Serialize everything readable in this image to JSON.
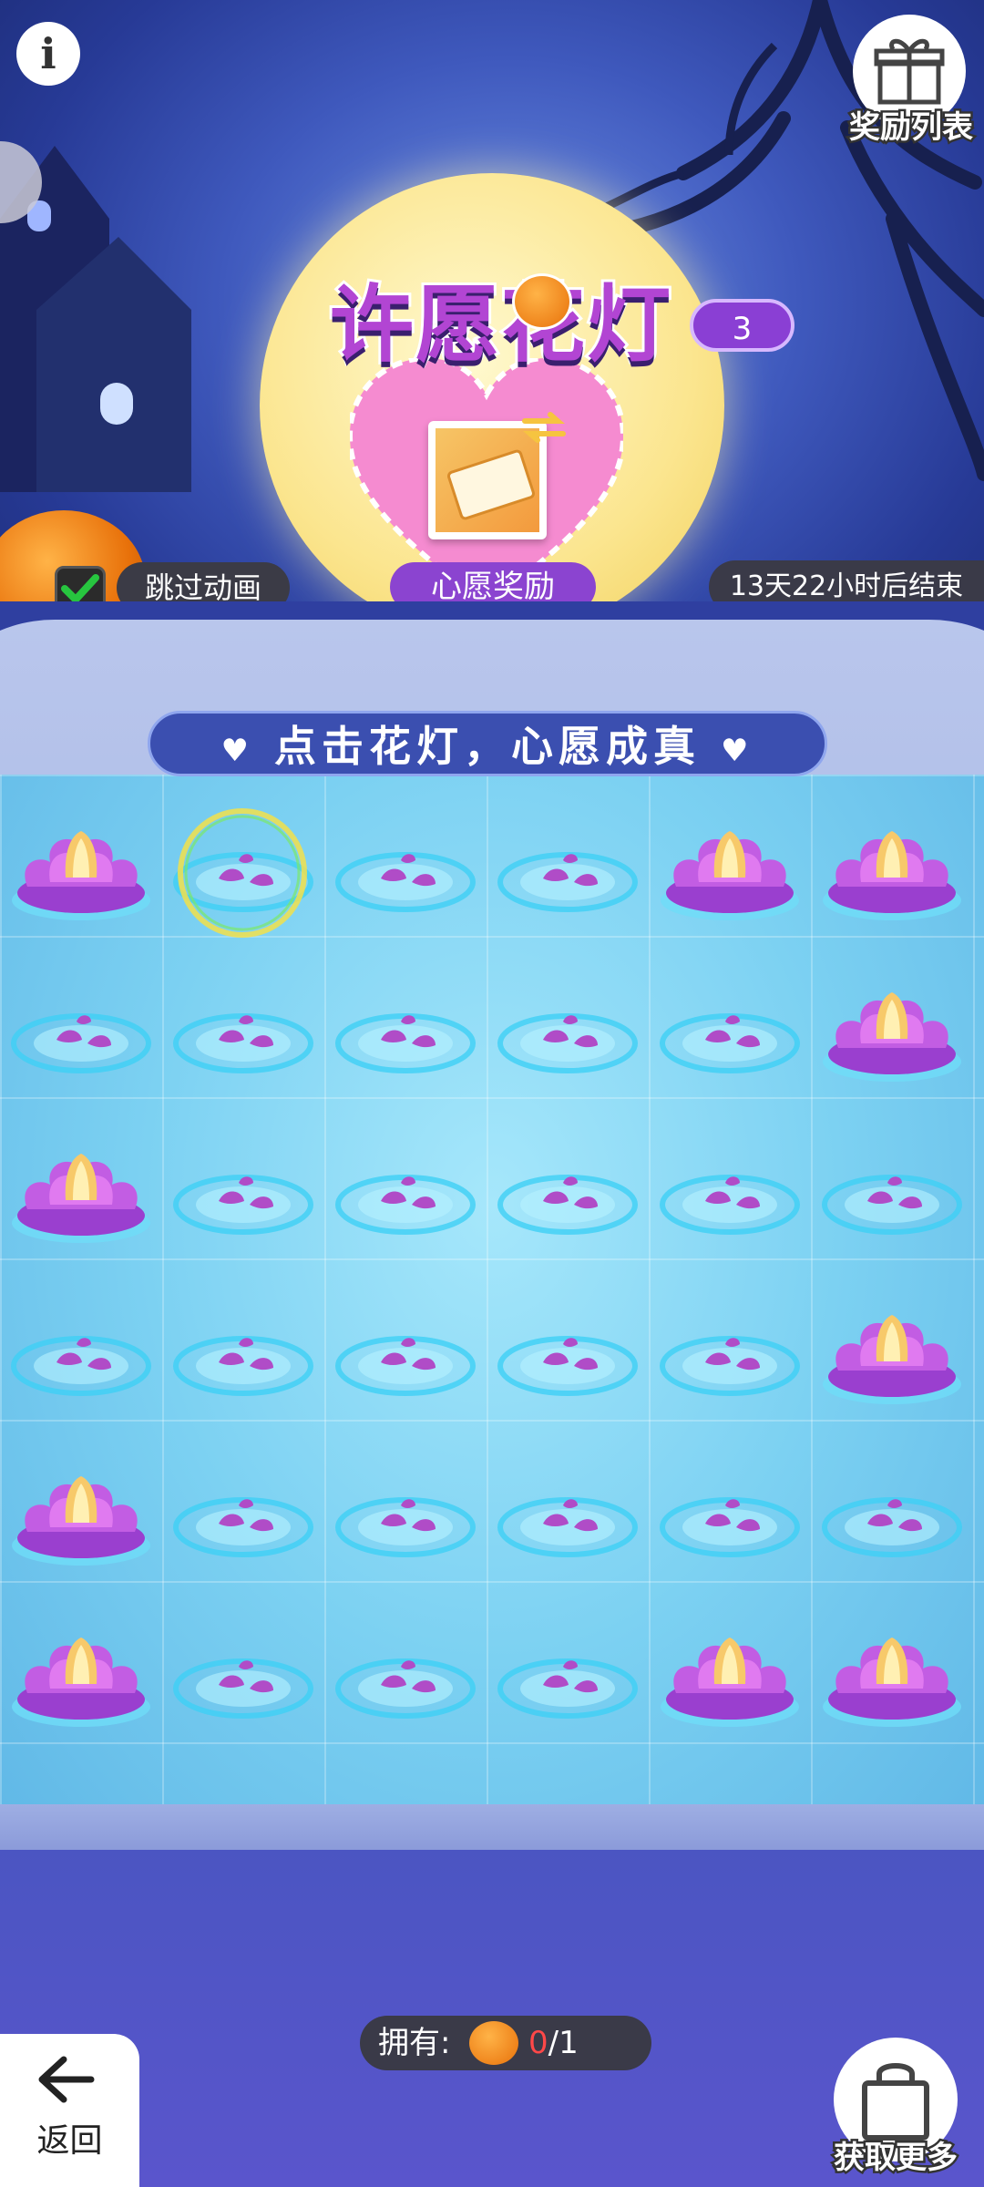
{
  "header": {
    "info_icon": "info-icon",
    "gift_icon": "gift-icon",
    "reward_list_label": "奖励列表"
  },
  "event": {
    "title": "许愿花灯",
    "level": "3",
    "reward_item_icon": "coupon-ticket-icon",
    "wish_reward_label": "心愿奖励",
    "skip_animation_label": "跳过动画",
    "skip_animation_checked": true,
    "countdown": "13天22小时后结束",
    "banner_text": "点击花灯，心愿成真"
  },
  "grid": {
    "rows": 6,
    "cols": 6,
    "cells": [
      [
        "lantern",
        "pad",
        "pad",
        "pad",
        "lantern",
        "lantern"
      ],
      [
        "pad",
        "pad",
        "pad",
        "pad",
        "pad",
        "lantern"
      ],
      [
        "lantern",
        "pad",
        "pad",
        "pad",
        "pad",
        "pad"
      ],
      [
        "pad",
        "pad",
        "pad",
        "pad",
        "pad",
        "lantern"
      ],
      [
        "lantern",
        "pad",
        "pad",
        "pad",
        "pad",
        "pad"
      ],
      [
        "lantern",
        "pad",
        "pad",
        "pad",
        "lantern",
        "lantern"
      ]
    ],
    "highlighted_cell": [
      0,
      1
    ]
  },
  "footer": {
    "back_label": "返回",
    "owned_label": "拥有:",
    "owned_current": "0",
    "owned_total": "/1",
    "get_more_label": "获取更多"
  },
  "colors": {
    "title_purple": "#b245d3",
    "badge_purple": "#8a3fd4",
    "count_red": "#ff4848",
    "water": "#7cd1f2"
  }
}
